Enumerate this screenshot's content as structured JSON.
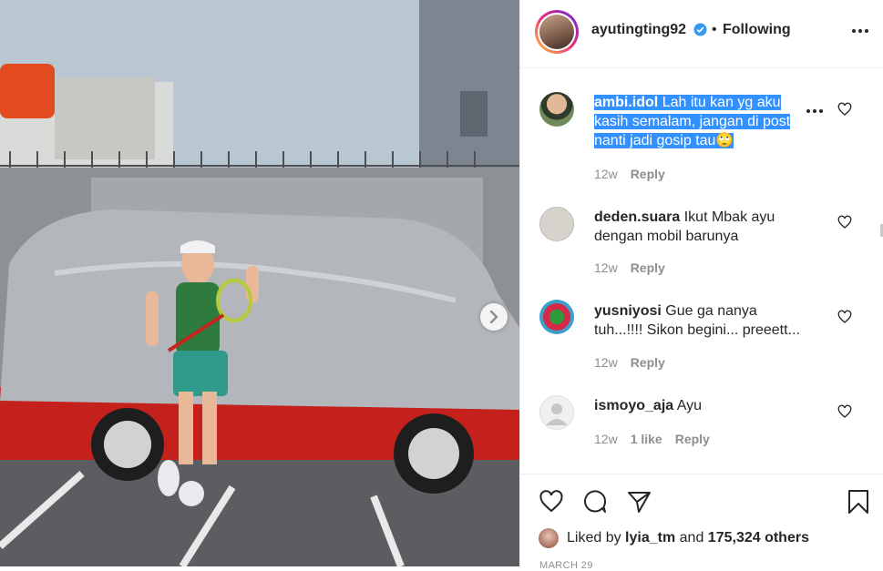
{
  "post": {
    "image_alt": "Woman in tennis outfit holding badminton racket beside covered van",
    "next_icon": "chevron-right-icon"
  },
  "header": {
    "username": "ayutingting92",
    "verified_icon": "verified-badge-icon",
    "separator": "•",
    "follow_status": "Following",
    "more_icon": "more-horizontal-icon"
  },
  "comments": [
    {
      "username": "ambi.idol",
      "text": "Lah itu kan yg aku kasih semalam, jangan di post nanti jadi gosip tau🙄",
      "time": "12w",
      "likes": "",
      "reply": "Reply",
      "selected": true
    },
    {
      "username": "deden.suara",
      "text": "Ikut Mbak ayu dengan mobil barunya",
      "time": "12w",
      "likes": "",
      "reply": "Reply",
      "selected": false
    },
    {
      "username": "yusniyosi",
      "text": "Gue ga nanya tuh...!!!! Sikon begini... preeett...",
      "time": "12w",
      "likes": "",
      "reply": "Reply",
      "selected": false
    },
    {
      "username": "ismoyo_aja",
      "text": "Ayu",
      "time": "12w",
      "likes": "1 like",
      "reply": "Reply",
      "selected": false
    }
  ],
  "actions": {
    "like_icon": "heart-icon",
    "comment_icon": "comment-bubble-icon",
    "share_icon": "paper-plane-icon",
    "save_icon": "bookmark-icon"
  },
  "likes_summary": {
    "prefix": "Liked by",
    "user": "lyia_tm",
    "middle": "and",
    "count": "175,324 others"
  },
  "date": "MARCH 29",
  "colors": {
    "selection": "#3390ff",
    "muted_text": "#8e8e8e",
    "primary_text": "#262626"
  }
}
